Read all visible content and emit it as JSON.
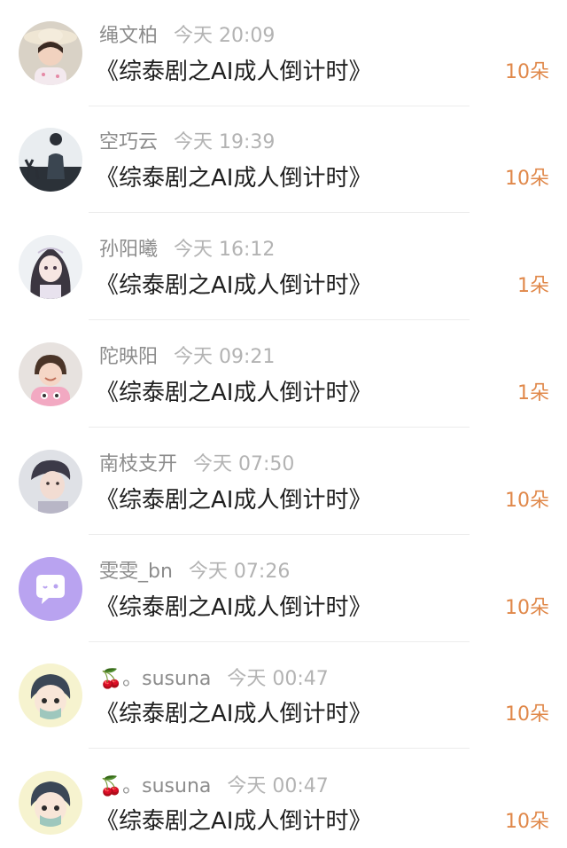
{
  "items": [
    {
      "name": "绳文柏",
      "time": "今天 20:09",
      "title": "《综泰剧之AI成人倒计时》",
      "count": "10朵",
      "avatar": "girl-straw-hat"
    },
    {
      "name": "空巧云",
      "time": "今天 19:39",
      "title": "《综泰剧之AI成人倒计时》",
      "count": "10朵",
      "avatar": "silhouette-with-deer"
    },
    {
      "name": "孙阳曦",
      "time": "今天 16:12",
      "title": "《综泰剧之AI成人倒计时》",
      "count": "1朵",
      "avatar": "anime-girl"
    },
    {
      "name": "陀映阳",
      "time": "今天 09:21",
      "title": "《综泰剧之AI成人倒计时》",
      "count": "1朵",
      "avatar": "child-pink-sweater"
    },
    {
      "name": "南枝支开",
      "time": "今天 07:50",
      "title": "《综泰剧之AI成人倒计时》",
      "count": "10朵",
      "avatar": "young-man"
    },
    {
      "name": "雯雯_bn",
      "time": "今天 07:26",
      "title": "《综泰剧之AI成人倒计时》",
      "count": "10朵",
      "avatar": "purple-chat-bubble"
    },
    {
      "name": "。susuna",
      "name_prefix": "🍒",
      "time": "今天 00:47",
      "title": "《综泰剧之AI成人倒计时》",
      "count": "10朵",
      "avatar": "cartoon-boy-mask"
    },
    {
      "name": "。susuna",
      "name_prefix": "🍒",
      "time": "今天 00:47",
      "title": "《综泰剧之AI成人倒计时》",
      "count": "10朵",
      "avatar": "cartoon-boy-mask"
    }
  ],
  "colors": {
    "count": "#e0884a",
    "title": "#1f1f1f",
    "meta": "#9a9a9a",
    "avatar_purple": "#b9a3f0"
  }
}
